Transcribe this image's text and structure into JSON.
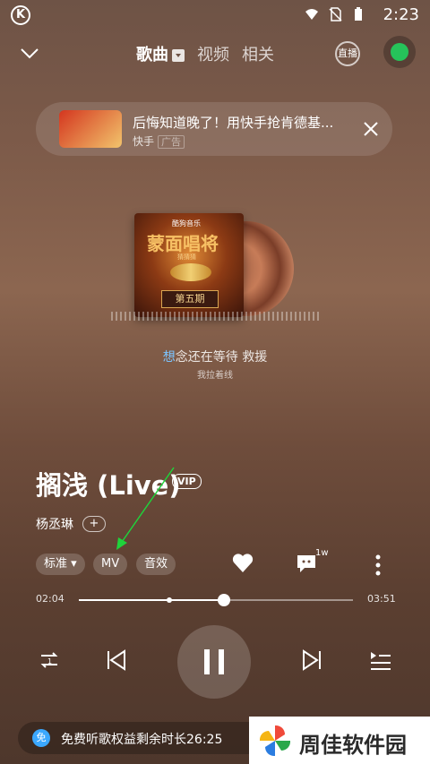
{
  "status_bar": {
    "time": "2:23"
  },
  "header": {
    "tabs": [
      {
        "label": "歌曲"
      },
      {
        "label": "视频"
      },
      {
        "label": "相关"
      }
    ],
    "live_label": "直播"
  },
  "ad": {
    "title": "后悔知道晚了！用快手抢肯德基...",
    "source": "快手",
    "tag": "广告"
  },
  "album": {
    "brand": "酷狗音乐",
    "title": "蒙面唱将",
    "subtitle": "猜猜猜",
    "episode": "第五期"
  },
  "lyrics": {
    "line1_highlight": "想",
    "line1_rest": "念还在等待 救援",
    "line2": "我拉着线"
  },
  "song": {
    "title": "搁浅 (Live)",
    "vip": "VIP",
    "artist": "杨丞琳",
    "follow": "+"
  },
  "options": {
    "quality": "标准",
    "mv": "MV",
    "effect": "音效",
    "comment_count": "1w"
  },
  "progress": {
    "current": "02:04",
    "total": "03:51",
    "played_fraction": 0.53,
    "marker_fraction": 0.33
  },
  "footer": {
    "free_badge": "免",
    "free_text": "免费听歌权益剩余时长26:25"
  },
  "watermark": {
    "text": "周佳软件园"
  }
}
